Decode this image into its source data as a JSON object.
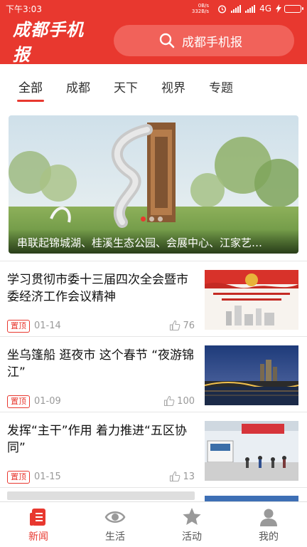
{
  "status_bar": {
    "time": "下午3:03",
    "rate_up": "0B/s",
    "rate_down": "332B/s",
    "network": "4G"
  },
  "header": {
    "logo": "成都手机报",
    "search_placeholder": "成都手机报"
  },
  "tabs": [
    {
      "label": "全部",
      "active": true
    },
    {
      "label": "成都",
      "active": false
    },
    {
      "label": "天下",
      "active": false
    },
    {
      "label": "视界",
      "active": false
    },
    {
      "label": "专题",
      "active": false
    }
  ],
  "banner": {
    "caption": "串联起锦城湖、桂溪生态公园、会展中心、江家艺…"
  },
  "news": [
    {
      "title": "学习贯彻市委十三届四次全会暨市委经济工作会议精神",
      "pin": "置顶",
      "date": "01-14",
      "likes": "76"
    },
    {
      "title": "坐乌篷船 逛夜市 这个春节 “夜游锦江”",
      "pin": "置顶",
      "date": "01-09",
      "likes": "100"
    },
    {
      "title": "发挥“主干”作用 着力推进“五区协同”",
      "pin": "置顶",
      "date": "01-15",
      "likes": "13"
    }
  ],
  "bottom_nav": [
    {
      "label": "新闻",
      "icon": "news-icon",
      "active": true
    },
    {
      "label": "生活",
      "icon": "eye-icon",
      "active": false
    },
    {
      "label": "活动",
      "icon": "star-icon",
      "active": false
    },
    {
      "label": "我的",
      "icon": "user-icon",
      "active": false
    }
  ],
  "colors": {
    "brand": "#e8382f"
  }
}
